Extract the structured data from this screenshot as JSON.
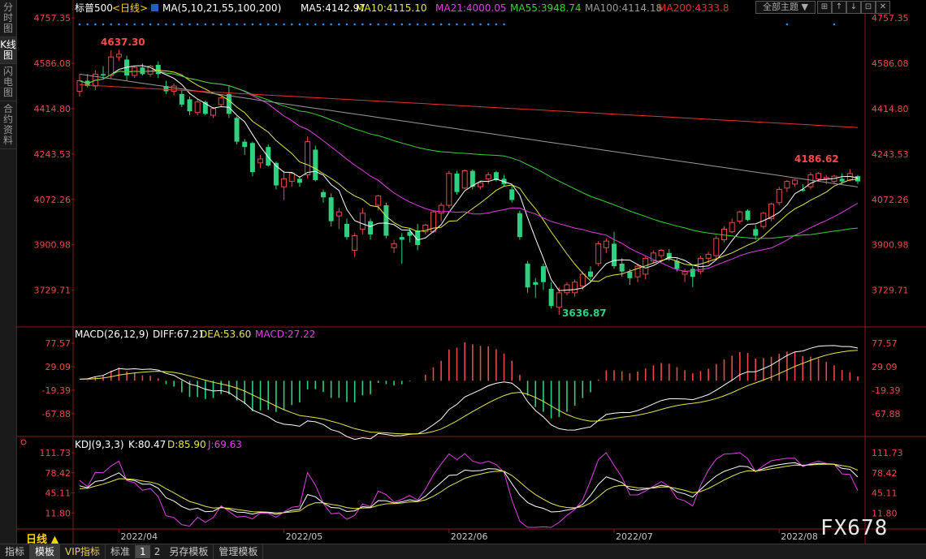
{
  "rail_tabs": [
    "分时图",
    "K线图",
    "闪电图",
    "合约资料"
  ],
  "main_header": {
    "symbol": "标普500",
    "period_tag": "<日线>",
    "ma_label": "MA(5,10,21,55,100,200)",
    "ma_values": [
      {
        "label": "MA5:4142.97",
        "color": "#ffffff"
      },
      {
        "label": "MA10:4115.10",
        "color": "#e6e64a"
      },
      {
        "label": "MA21:4000.05",
        "color": "#e040e0"
      },
      {
        "label": "MA55:3948.74",
        "color": "#3ad13a"
      },
      {
        "label": "MA100:4114.18",
        "color": "#9a9a9a"
      },
      {
        "label": "MA200:4333.8",
        "color": "#e83030"
      }
    ],
    "theme_button": "全部主题",
    "mini_buttons": [
      "⊞",
      "↑",
      "↓",
      "⊡",
      "✕"
    ]
  },
  "price_axis": {
    "ticks": [
      "4757.35",
      "4586.08",
      "4414.80",
      "4243.53",
      "4072.26",
      "3900.98",
      "3729.71"
    ],
    "min": 3600,
    "max": 4757.35
  },
  "macd_header": {
    "label": "MACD(26,12,9)",
    "diff": "DIFF:67.21",
    "dea": "DEA:53.60",
    "macd": "MACD:27.22"
  },
  "macd_axis": {
    "ticks": [
      "77.57",
      "29.09",
      "-19.39",
      "-67.88"
    ],
    "min": -110,
    "max": 77.57
  },
  "kdj_header": {
    "label": "KDJ(9,3,3)",
    "k": "K:80.47",
    "d": "D:85.90",
    "j": "J:69.63"
  },
  "kdj_axis": {
    "ticks": [
      "111.73",
      "78.42",
      "45.11",
      "11.80"
    ],
    "min": -12,
    "max": 111.73
  },
  "date_axis": [
    "2022/04",
    "2022/05",
    "2022/06",
    "2022/07",
    "2022/08"
  ],
  "annotations": {
    "high": "4637.30",
    "low": "3636.87",
    "recent_high": "4186.62"
  },
  "period_label": "日线 ▲",
  "toolbar": {
    "items": [
      "指标",
      "模板",
      "VIP指标",
      "标准"
    ],
    "numbers": [
      "1",
      "2"
    ],
    "items_after": [
      "另存模板",
      "管理模板"
    ]
  },
  "watermark": "FX678",
  "colors": {
    "up": "#e84a4a",
    "down": "#2ed17f",
    "diff": "#ffffff",
    "dea": "#e6e64a",
    "k": "#ffffff",
    "d": "#e6e64a",
    "j": "#e040e0",
    "axis": "#8b1a1a",
    "dot": "#3a8ee6"
  },
  "chart_data": {
    "type": "candlestick",
    "candles": [
      {
        "o": 4480,
        "h": 4545,
        "l": 4460,
        "c": 4520
      },
      {
        "o": 4520,
        "h": 4545,
        "l": 4495,
        "c": 4500
      },
      {
        "o": 4500,
        "h": 4560,
        "l": 4485,
        "c": 4545
      },
      {
        "o": 4545,
        "h": 4575,
        "l": 4525,
        "c": 4540
      },
      {
        "o": 4540,
        "h": 4635,
        "l": 4530,
        "c": 4610
      },
      {
        "o": 4610,
        "h": 4637.3,
        "l": 4595,
        "c": 4620
      },
      {
        "o": 4600,
        "h": 4615,
        "l": 4520,
        "c": 4540
      },
      {
        "o": 4540,
        "h": 4575,
        "l": 4530,
        "c": 4570
      },
      {
        "o": 4570,
        "h": 4585,
        "l": 4540,
        "c": 4545
      },
      {
        "o": 4545,
        "h": 4580,
        "l": 4535,
        "c": 4575
      },
      {
        "o": 4580,
        "h": 4593,
        "l": 4530,
        "c": 4545
      },
      {
        "o": 4500,
        "h": 4520,
        "l": 4470,
        "c": 4480
      },
      {
        "o": 4480,
        "h": 4510,
        "l": 4465,
        "c": 4500
      },
      {
        "o": 4470,
        "h": 4485,
        "l": 4420,
        "c": 4430
      },
      {
        "o": 4450,
        "h": 4460,
        "l": 4390,
        "c": 4405
      },
      {
        "o": 4400,
        "h": 4450,
        "l": 4390,
        "c": 4440
      },
      {
        "o": 4440,
        "h": 4445,
        "l": 4390,
        "c": 4395
      },
      {
        "o": 4390,
        "h": 4420,
        "l": 4380,
        "c": 4415
      },
      {
        "o": 4430,
        "h": 4460,
        "l": 4420,
        "c": 4455
      },
      {
        "o": 4470,
        "h": 4500,
        "l": 4380,
        "c": 4395
      },
      {
        "o": 4380,
        "h": 4385,
        "l": 4280,
        "c": 4290
      },
      {
        "o": 4290,
        "h": 4300,
        "l": 4240,
        "c": 4270
      },
      {
        "o": 4285,
        "h": 4290,
        "l": 4160,
        "c": 4175
      },
      {
        "o": 4210,
        "h": 4240,
        "l": 4190,
        "c": 4225
      },
      {
        "o": 4270,
        "h": 4280,
        "l": 4195,
        "c": 4200
      },
      {
        "o": 4210,
        "h": 4215,
        "l": 4110,
        "c": 4125
      },
      {
        "o": 4120,
        "h": 4180,
        "l": 4070,
        "c": 4150
      },
      {
        "o": 4140,
        "h": 4175,
        "l": 4120,
        "c": 4170
      },
      {
        "o": 4150,
        "h": 4160,
        "l": 4120,
        "c": 4135
      },
      {
        "o": 4165,
        "h": 4310,
        "l": 4150,
        "c": 4290
      },
      {
        "o": 4260,
        "h": 4275,
        "l": 4140,
        "c": 4145
      },
      {
        "o": 4100,
        "h": 4110,
        "l": 4060,
        "c": 4080
      },
      {
        "o": 4080,
        "h": 4095,
        "l": 3970,
        "c": 3990
      },
      {
        "o": 4010,
        "h": 4040,
        "l": 3960,
        "c": 4025
      },
      {
        "o": 3980,
        "h": 4000,
        "l": 3920,
        "c": 3930
      },
      {
        "o": 3880,
        "h": 3945,
        "l": 3855,
        "c": 3935
      },
      {
        "o": 3960,
        "h": 4040,
        "l": 3940,
        "c": 4020
      },
      {
        "o": 3990,
        "h": 4000,
        "l": 3920,
        "c": 3940
      },
      {
        "o": 4050,
        "h": 4090,
        "l": 4030,
        "c": 4085
      },
      {
        "o": 4050,
        "h": 4060,
        "l": 3925,
        "c": 3935
      },
      {
        "o": 3890,
        "h": 3920,
        "l": 3870,
        "c": 3905
      },
      {
        "o": 3930,
        "h": 3945,
        "l": 3830,
        "c": 3920
      },
      {
        "o": 3950,
        "h": 3965,
        "l": 3910,
        "c": 3935
      },
      {
        "o": 3955,
        "h": 3980,
        "l": 3880,
        "c": 3900
      },
      {
        "o": 3950,
        "h": 3980,
        "l": 3940,
        "c": 3975
      },
      {
        "o": 3950,
        "h": 4030,
        "l": 3945,
        "c": 4025
      },
      {
        "o": 4020,
        "h": 4060,
        "l": 3990,
        "c": 4050
      },
      {
        "o": 4050,
        "h": 4180,
        "l": 4040,
        "c": 4170
      },
      {
        "o": 4170,
        "h": 4180,
        "l": 4090,
        "c": 4100
      },
      {
        "o": 4115,
        "h": 4185,
        "l": 4110,
        "c": 4180
      },
      {
        "o": 4180,
        "h": 4185,
        "l": 4110,
        "c": 4120
      },
      {
        "o": 4120,
        "h": 4140,
        "l": 4110,
        "c": 4135
      },
      {
        "o": 4150,
        "h": 4175,
        "l": 4130,
        "c": 4165
      },
      {
        "o": 4175,
        "h": 4180,
        "l": 4140,
        "c": 4145
      },
      {
        "o": 4150,
        "h": 4165,
        "l": 4120,
        "c": 4130
      },
      {
        "o": 4110,
        "h": 4125,
        "l": 4060,
        "c": 4070
      },
      {
        "o": 4020,
        "h": 4030,
        "l": 3920,
        "c": 3930
      },
      {
        "o": 3830,
        "h": 3840,
        "l": 3720,
        "c": 3740
      },
      {
        "o": 3760,
        "h": 3775,
        "l": 3700,
        "c": 3750
      },
      {
        "o": 3820,
        "h": 3830,
        "l": 3730,
        "c": 3760
      },
      {
        "o": 3735,
        "h": 3760,
        "l": 3660,
        "c": 3670
      },
      {
        "o": 3665,
        "h": 3740,
        "l": 3636.87,
        "c": 3720
      },
      {
        "o": 3720,
        "h": 3760,
        "l": 3710,
        "c": 3750
      },
      {
        "o": 3720,
        "h": 3770,
        "l": 3705,
        "c": 3760
      },
      {
        "o": 3745,
        "h": 3800,
        "l": 3730,
        "c": 3790
      },
      {
        "o": 3800,
        "h": 3820,
        "l": 3770,
        "c": 3780
      },
      {
        "o": 3830,
        "h": 3915,
        "l": 3820,
        "c": 3905
      },
      {
        "o": 3890,
        "h": 3925,
        "l": 3870,
        "c": 3915
      },
      {
        "o": 3905,
        "h": 3950,
        "l": 3810,
        "c": 3820
      },
      {
        "o": 3830,
        "h": 3850,
        "l": 3780,
        "c": 3800
      },
      {
        "o": 3800,
        "h": 3810,
        "l": 3750,
        "c": 3775
      },
      {
        "o": 3780,
        "h": 3830,
        "l": 3760,
        "c": 3820
      },
      {
        "o": 3790,
        "h": 3860,
        "l": 3770,
        "c": 3850
      },
      {
        "o": 3840,
        "h": 3880,
        "l": 3830,
        "c": 3870
      },
      {
        "o": 3860,
        "h": 3885,
        "l": 3850,
        "c": 3880
      },
      {
        "o": 3870,
        "h": 3885,
        "l": 3840,
        "c": 3850
      },
      {
        "o": 3840,
        "h": 3850,
        "l": 3800,
        "c": 3810
      },
      {
        "o": 3790,
        "h": 3810,
        "l": 3760,
        "c": 3800
      },
      {
        "o": 3810,
        "h": 3820,
        "l": 3740,
        "c": 3780
      },
      {
        "o": 3800,
        "h": 3860,
        "l": 3790,
        "c": 3850
      },
      {
        "o": 3850,
        "h": 3875,
        "l": 3830,
        "c": 3865
      },
      {
        "o": 3860,
        "h": 3935,
        "l": 3850,
        "c": 3925
      },
      {
        "o": 3920,
        "h": 3970,
        "l": 3910,
        "c": 3960
      },
      {
        "o": 3950,
        "h": 4000,
        "l": 3945,
        "c": 3985
      },
      {
        "o": 3990,
        "h": 4030,
        "l": 3980,
        "c": 4025
      },
      {
        "o": 4030,
        "h": 4035,
        "l": 3990,
        "c": 3995
      },
      {
        "o": 3960,
        "h": 3975,
        "l": 3920,
        "c": 3935
      },
      {
        "o": 3970,
        "h": 4025,
        "l": 3960,
        "c": 4020
      },
      {
        "o": 4000,
        "h": 4060,
        "l": 3990,
        "c": 4055
      },
      {
        "o": 4060,
        "h": 4120,
        "l": 4050,
        "c": 4110
      },
      {
        "o": 4115,
        "h": 4145,
        "l": 4100,
        "c": 4140
      },
      {
        "o": 4130,
        "h": 4150,
        "l": 4120,
        "c": 4145
      },
      {
        "o": 4110,
        "h": 4130,
        "l": 4100,
        "c": 4105
      },
      {
        "o": 4120,
        "h": 4175,
        "l": 4110,
        "c": 4165
      },
      {
        "o": 4150,
        "h": 4175,
        "l": 4140,
        "c": 4170
      },
      {
        "o": 4150,
        "h": 4165,
        "l": 4130,
        "c": 4155
      },
      {
        "o": 4140,
        "h": 4165,
        "l": 4130,
        "c": 4160
      },
      {
        "o": 4150,
        "h": 4170,
        "l": 4130,
        "c": 4140
      },
      {
        "o": 4145,
        "h": 4186.62,
        "l": 4140,
        "c": 4170
      },
      {
        "o": 4160,
        "h": 4165,
        "l": 4130,
        "c": 4140
      }
    ]
  }
}
